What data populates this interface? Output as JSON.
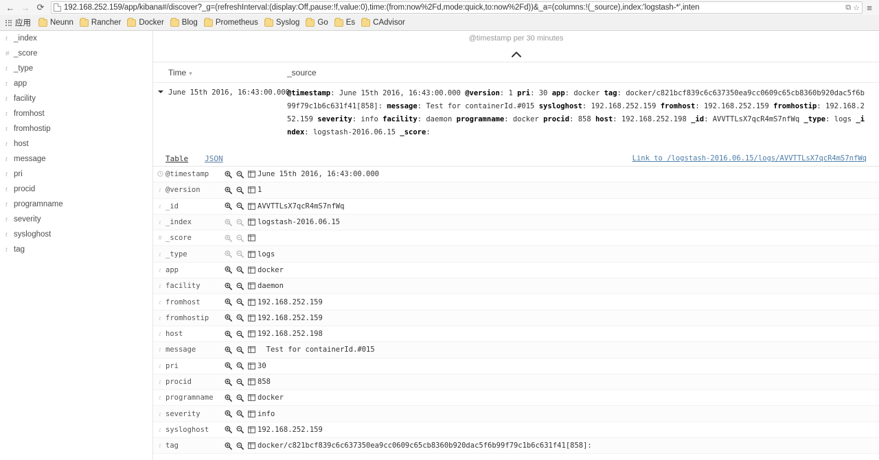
{
  "browser": {
    "back_icon": "←",
    "forward_icon": "→",
    "reload_icon": "⟳",
    "url_host": "192.168.252.159",
    "url_rest": "/app/kibana#/discover?_g=(refreshInterval:(display:Off,pause:!f,value:0),time:(from:now%2Fd,mode:quick,to:now%2Fd))&_a=(columns:!(_source),index:'logstash-*',inten",
    "url_full": "192.168.252.159/app/kibana#/discover?_g=(refreshInterval:(display:Off,pause:!f,value:0),time:(from:now%2Fd,mode:quick,to:now%2Fd))&_a=(columns:!(_source),index:'logstash-*',inten",
    "cast_icon": "⧉",
    "star_icon": "☆",
    "menu_icon": "≡",
    "apps_label": "应用",
    "bookmarks": [
      "Neunn",
      "Rancher",
      "Docker",
      "Blog",
      "Prometheus",
      "Syslog",
      "Go",
      "Es",
      "CAdvisor"
    ]
  },
  "sidebar": {
    "fields": [
      {
        "name": "_index",
        "type": "t"
      },
      {
        "name": "_score",
        "type": "#"
      },
      {
        "name": "_type",
        "type": "t"
      },
      {
        "name": "app",
        "type": "t"
      },
      {
        "name": "facility",
        "type": "t"
      },
      {
        "name": "fromhost",
        "type": "t"
      },
      {
        "name": "fromhostip",
        "type": "t"
      },
      {
        "name": "host",
        "type": "t"
      },
      {
        "name": "message",
        "type": "t"
      },
      {
        "name": "pri",
        "type": "t"
      },
      {
        "name": "procid",
        "type": "t"
      },
      {
        "name": "programname",
        "type": "t"
      },
      {
        "name": "severity",
        "type": "t"
      },
      {
        "name": "sysloghost",
        "type": "t"
      },
      {
        "name": "tag",
        "type": "t"
      }
    ]
  },
  "chart": {
    "axis_label": "@timestamp per 30 minutes",
    "collapse_icon": "⌃"
  },
  "table": {
    "header": {
      "expand": "",
      "time": "Time",
      "time_sort_caret": "▾",
      "source": "_source"
    },
    "row": {
      "expand_caret": "▾",
      "time": "June 15th 2016, 16:43:00.000",
      "source_pairs": [
        {
          "key": "@timestamp",
          "value": "June 15th 2016, 16:43:00.000"
        },
        {
          "key": "@version",
          "value": "1"
        },
        {
          "key": "pri",
          "value": "30"
        },
        {
          "key": "app",
          "value": "docker"
        },
        {
          "key": "tag",
          "value": "docker/c821bcf839c6c637350ea9cc0609c65cb8360b920dac5f6b99f79c1b6c631f41[858]:"
        },
        {
          "key": "message",
          "value": " Test for containerId.#015"
        },
        {
          "key": "sysloghost",
          "value": "192.168.252.159"
        },
        {
          "key": "fromhost",
          "value": "192.168.252.159"
        },
        {
          "key": "fromhostip",
          "value": "192.168.252.159"
        },
        {
          "key": "severity",
          "value": "info"
        },
        {
          "key": "facility",
          "value": "daemon"
        },
        {
          "key": "programname",
          "value": "docker"
        },
        {
          "key": "procid",
          "value": "858"
        },
        {
          "key": "host",
          "value": "192.168.252.198"
        },
        {
          "key": "_id",
          "value": "AVVTTLsX7qcR4mS7nfWq"
        },
        {
          "key": "_type",
          "value": "logs"
        },
        {
          "key": "_index",
          "value": "logstash-2016.06.15"
        },
        {
          "key": "_score",
          "value": ""
        }
      ]
    }
  },
  "detail": {
    "tabs": [
      {
        "label": "Table",
        "active": true
      },
      {
        "label": "JSON",
        "active": false
      }
    ],
    "link_label": "Link to /logstash-2016.06.15/logs/AVVTTLsX7qcR4mS7nfWq",
    "action_icons": {
      "filter_for": "zoom-in-icon",
      "filter_out": "zoom-out-icon",
      "toggle_column": "toggle-column-icon"
    },
    "rows": [
      {
        "type": "clock",
        "name": "@timestamp",
        "value": "June 15th 2016, 16:43:00.000",
        "enabled": true
      },
      {
        "type": "t",
        "name": "@version",
        "value": "1",
        "enabled": true
      },
      {
        "type": "t",
        "name": "_id",
        "value": "AVVTTLsX7qcR4mS7nfWq",
        "enabled": true
      },
      {
        "type": "t",
        "name": "_index",
        "value": "logstash-2016.06.15",
        "enabled": false
      },
      {
        "type": "#",
        "name": "_score",
        "value": "",
        "enabled": false
      },
      {
        "type": "t",
        "name": "_type",
        "value": "logs",
        "enabled": false
      },
      {
        "type": "t",
        "name": "app",
        "value": "docker",
        "enabled": true
      },
      {
        "type": "t",
        "name": "facility",
        "value": "daemon",
        "enabled": true
      },
      {
        "type": "t",
        "name": "fromhost",
        "value": "192.168.252.159",
        "enabled": true
      },
      {
        "type": "t",
        "name": "fromhostip",
        "value": "192.168.252.159",
        "enabled": true
      },
      {
        "type": "t",
        "name": "host",
        "value": "192.168.252.198",
        "enabled": true
      },
      {
        "type": "t",
        "name": "message",
        "value": "  Test for containerId.#015",
        "enabled": true
      },
      {
        "type": "t",
        "name": "pri",
        "value": "30",
        "enabled": true
      },
      {
        "type": "t",
        "name": "procid",
        "value": "858",
        "enabled": true
      },
      {
        "type": "t",
        "name": "programname",
        "value": "docker",
        "enabled": true
      },
      {
        "type": "t",
        "name": "severity",
        "value": "info",
        "enabled": true
      },
      {
        "type": "t",
        "name": "sysloghost",
        "value": "192.168.252.159",
        "enabled": true
      },
      {
        "type": "t",
        "name": "tag",
        "value": "docker/c821bcf839c6c637350ea9cc0609c65cb8360b920dac5f6b99f79c1b6c631f41[858]:",
        "enabled": true
      }
    ]
  },
  "colors": {
    "chrome_bg": "#f1f1f1",
    "link": "#4d7eaa",
    "text": "#333333",
    "muted": "#999999",
    "bookmark_folder": "#f7d98a"
  }
}
